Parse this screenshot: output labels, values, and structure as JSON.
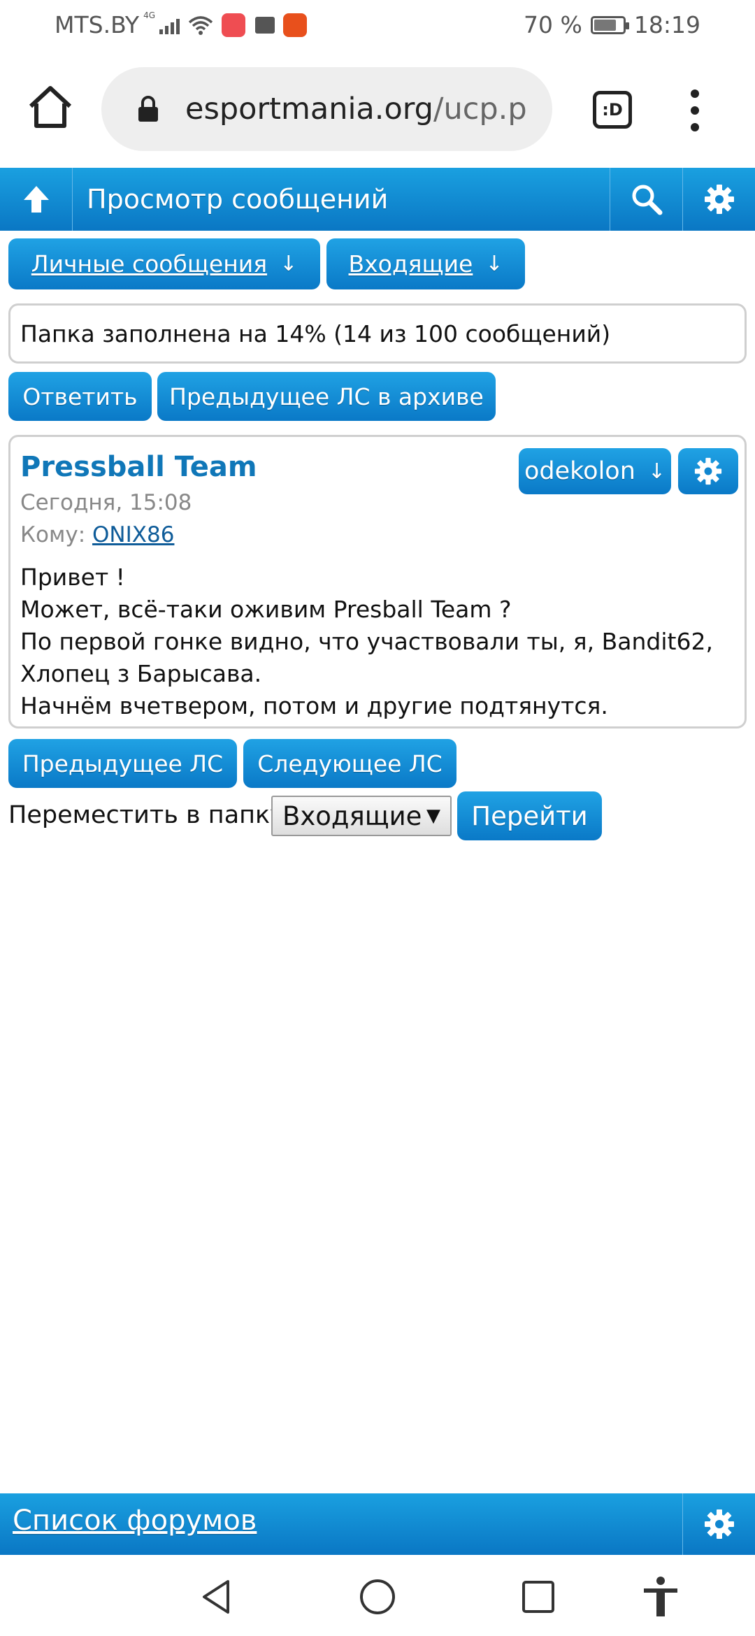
{
  "status_bar": {
    "carrier": "MTS.BY",
    "network": "4G",
    "battery": "70 %",
    "battery_level": 0.7,
    "time": "18:19"
  },
  "browser": {
    "url_host": "esportmania.org",
    "url_path": "/ucp.p",
    "tabs_icon_label": ":D"
  },
  "header": {
    "title": "Просмотр сообщений"
  },
  "nav": {
    "pm_dropdown": "Личные сообщения",
    "inbox_dropdown": "Входящие",
    "arrow": "↓"
  },
  "folder_status": "Папка заполнена на 14% (14 из 100 сообщений)",
  "actions": {
    "reply": "Ответить",
    "prev_archive": "Предыдущее ЛС в архиве"
  },
  "message": {
    "subject": "Pressball Team",
    "date": "Сегодня, 15:08",
    "to_label": "Кому:",
    "to_user": "ONIX86",
    "author": "odekolon",
    "body": [
      "Привет !",
      "Может, всё-таки оживим Presball Team ?",
      "По первой гонке видно, что участвовали ты, я, Bandit62,",
      "Хлопец з Барысава.",
      "Начнём вчетвером, потом и другие подтянутся."
    ]
  },
  "pagination": {
    "prev": "Предыдущее ЛС",
    "next": "Следующее ЛС"
  },
  "move": {
    "label": "Переместить в папку:",
    "selected_folder": "Входящие",
    "caret": "▼",
    "go": "Перейти"
  },
  "footer": {
    "forum_list": "Список форумов"
  },
  "colors": {
    "accent": "#0a79c7",
    "subject": "#1077b8"
  }
}
